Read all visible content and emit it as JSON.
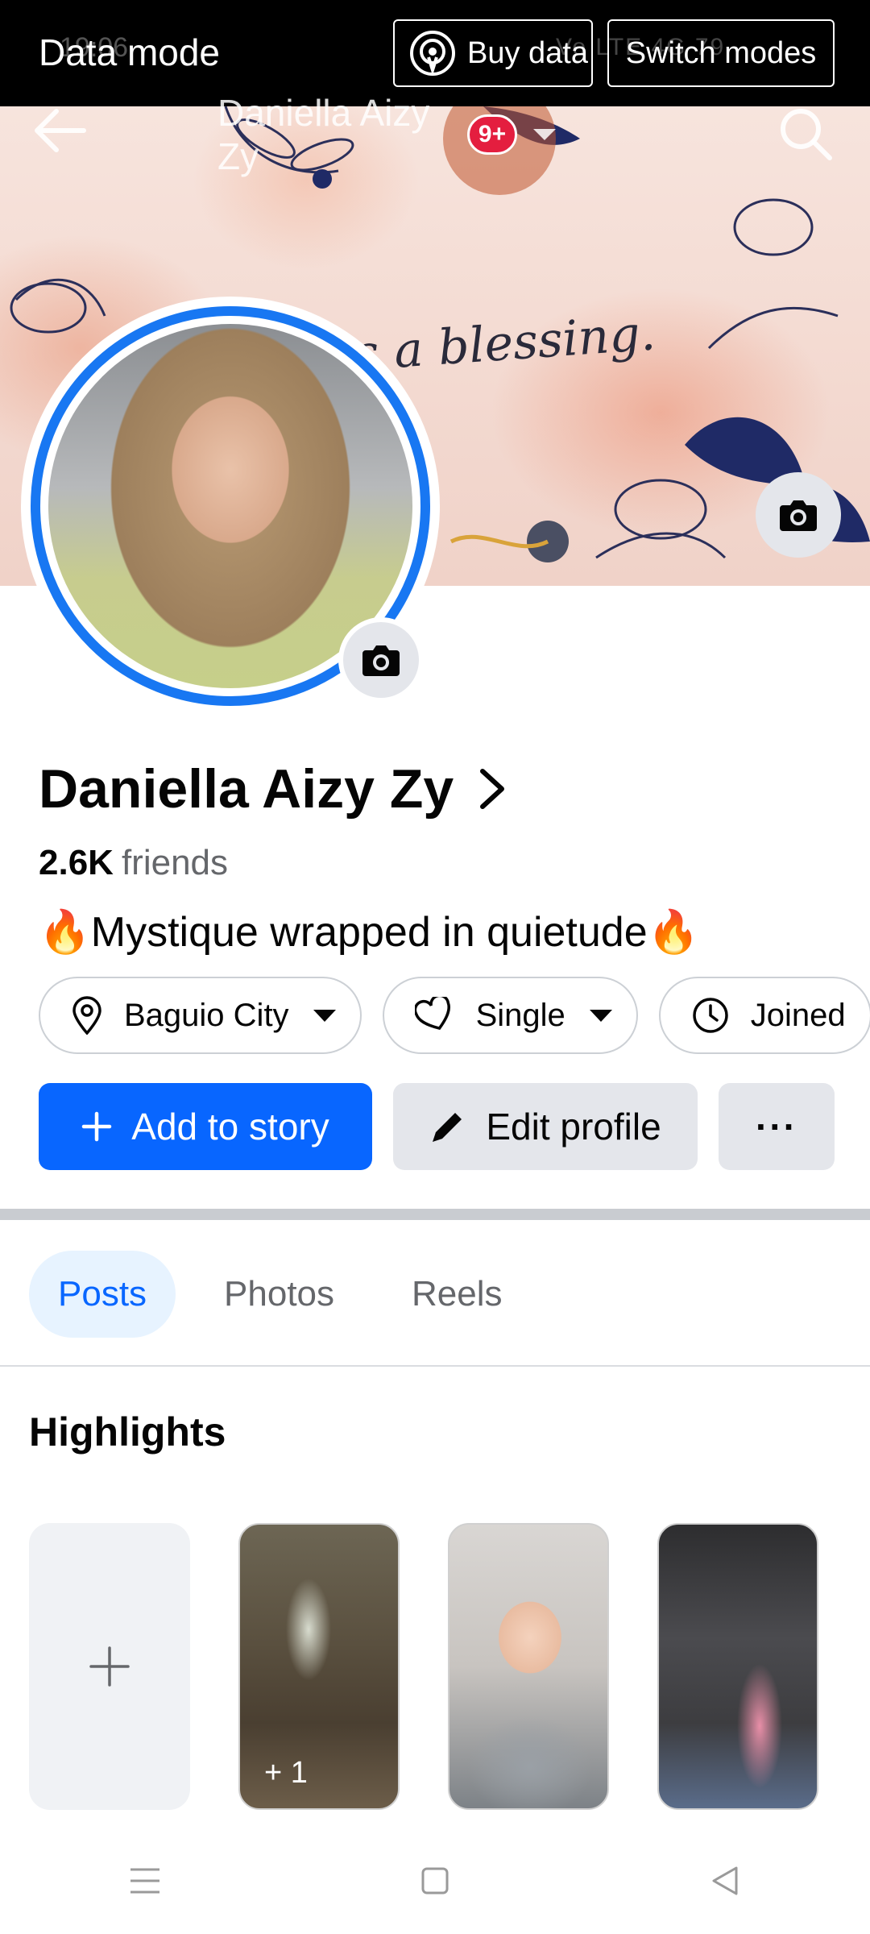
{
  "data_mode_banner": {
    "label": "Data mode",
    "buy_data_label": "Buy data",
    "switch_modes_label": "Switch modes",
    "status_time_ghost": "19:06",
    "status_right_ghost": "Vo LTE 4G 79"
  },
  "header": {
    "title": "Daniella Aizy Zy",
    "notification_count": "9+",
    "back_icon": "back-arrow-icon",
    "search_icon": "search-icon"
  },
  "cover": {
    "caption_text": "is a blessing."
  },
  "profile": {
    "name": "Daniella Aizy Zy",
    "friends_count": "2.6K",
    "friends_label": "friends",
    "bio": "🔥Mystique wrapped in quietude🔥"
  },
  "chips": [
    {
      "label": "Baguio City",
      "icon": "location-pin-icon"
    },
    {
      "label": "Single",
      "icon": "heart-icon"
    },
    {
      "label": "Joined",
      "icon": "clock-icon"
    }
  ],
  "actions": {
    "add_story_label": "Add to story",
    "edit_profile_label": "Edit profile",
    "more_label": "···"
  },
  "tabs": [
    {
      "label": "Posts",
      "active": true
    },
    {
      "label": "Photos",
      "active": false
    },
    {
      "label": "Reels",
      "active": false
    }
  ],
  "highlights": {
    "title": "Highlights",
    "extra_count": "+ 1"
  },
  "colors": {
    "accent": "#0866ff",
    "ring": "#1877f2",
    "badge": "#e41e3f"
  }
}
